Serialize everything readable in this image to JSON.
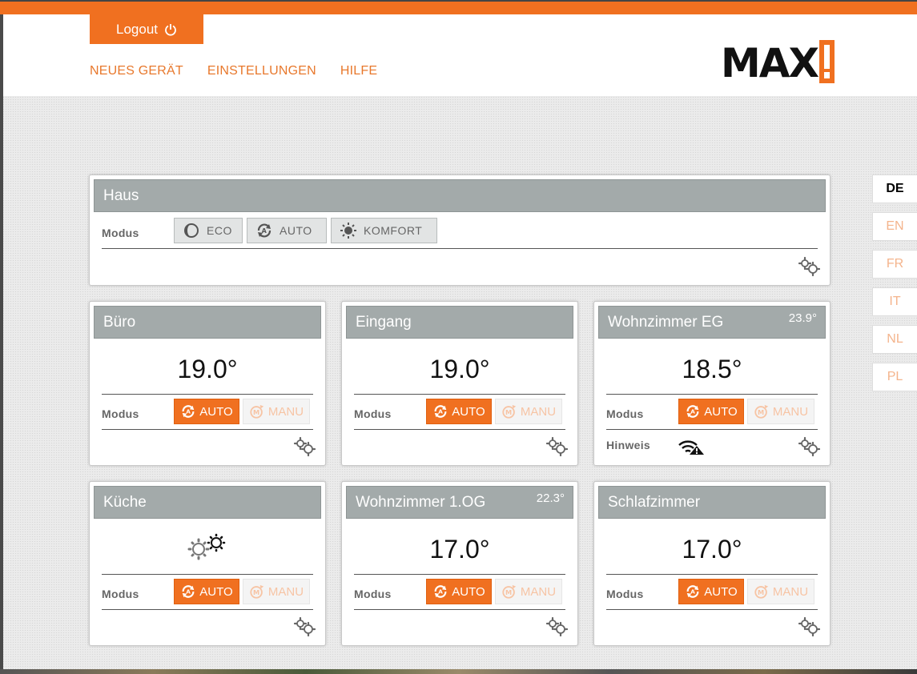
{
  "header": {
    "logout_label": "Logout",
    "nav": [
      "NEUES GERÄT",
      "EINSTELLUNGEN",
      "HILFE"
    ],
    "logo_text": "MAX"
  },
  "languages": [
    {
      "code": "DE",
      "active": true
    },
    {
      "code": "EN",
      "active": false
    },
    {
      "code": "FR",
      "active": false
    },
    {
      "code": "IT",
      "active": false
    },
    {
      "code": "NL",
      "active": false
    },
    {
      "code": "PL",
      "active": false
    }
  ],
  "haus": {
    "title": "Haus",
    "modus_label": "Modus",
    "buttons": [
      "ECO",
      "AUTO",
      "KOMFORT"
    ]
  },
  "rooms": [
    {
      "name": "Büro",
      "setpoint": "19.0°",
      "temp": "",
      "hint": ""
    },
    {
      "name": "Eingang",
      "setpoint": "19.0°",
      "temp": "",
      "hint": ""
    },
    {
      "name": "Wohnzimmer EG",
      "setpoint": "18.5°",
      "temp": "23.9°",
      "hint": "Hinweis"
    },
    {
      "name": "Küche",
      "setpoint": "",
      "temp": "",
      "hint": ""
    },
    {
      "name": "Wohnzimmer 1.OG",
      "setpoint": "17.0°",
      "temp": "22.3°",
      "hint": ""
    },
    {
      "name": "Schlafzimmer",
      "setpoint": "17.0°",
      "temp": "",
      "hint": ""
    }
  ],
  "room_labels": {
    "modus": "Modus",
    "auto": "AUTO",
    "manu": "MANU"
  },
  "colors": {
    "accent": "#f07020",
    "title_bar": "#a3aaaa"
  },
  "icons": {
    "logout": "power-icon",
    "eco": "moon-icon",
    "auto": "auto-cycle-icon",
    "komfort": "sun-icon",
    "settings": "gears-icon",
    "warning": "wifi-warning-icon"
  }
}
